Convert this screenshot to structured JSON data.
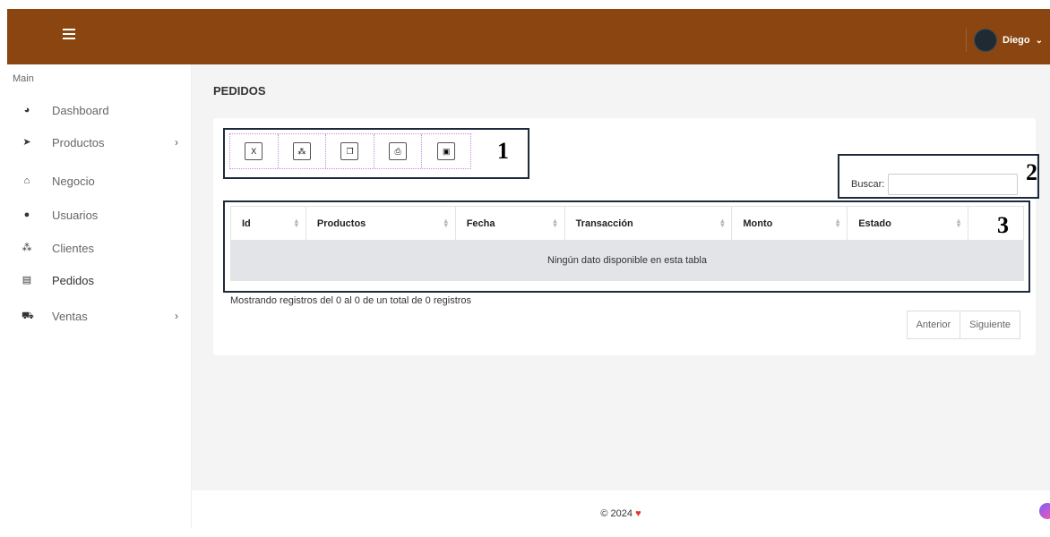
{
  "header": {
    "user_name": "Diego",
    "user_chevron": "⌄",
    "colors": {
      "bar": "#8b4511"
    }
  },
  "sidebar": {
    "section_label": "Main",
    "items": [
      {
        "label": "Dashboard",
        "icon": "pie-chart-icon",
        "glyph": "◕",
        "has_chevron": false
      },
      {
        "label": "Productos",
        "icon": "tags-icon",
        "glyph": "➤",
        "has_chevron": true
      },
      {
        "label": "Negocio",
        "icon": "home-icon",
        "glyph": "⌂",
        "has_chevron": false
      },
      {
        "label": "Usuarios",
        "icon": "user-icon",
        "glyph": "●",
        "has_chevron": false
      },
      {
        "label": "Clientes",
        "icon": "users-icon",
        "glyph": "⁂",
        "has_chevron": false
      },
      {
        "label": "Pedidos",
        "icon": "list-icon",
        "glyph": "▤",
        "has_chevron": false
      },
      {
        "label": "Ventas",
        "icon": "cart-icon",
        "glyph": "⛟",
        "has_chevron": true
      }
    ],
    "chevron": "›"
  },
  "page": {
    "title": "PEDIDOS"
  },
  "export_buttons": [
    {
      "name": "excel-export",
      "icon": "file-excel-icon",
      "glyph": "X"
    },
    {
      "name": "pdf-export",
      "icon": "file-pdf-icon",
      "glyph": "⁂"
    },
    {
      "name": "copy-export",
      "icon": "copy-icon",
      "glyph": "❐"
    },
    {
      "name": "print-export",
      "icon": "print-icon",
      "glyph": "⎙"
    },
    {
      "name": "csv-export",
      "icon": "file-csv-icon",
      "glyph": "▣"
    }
  ],
  "annotations": {
    "one": "1",
    "two": "2",
    "three": "3"
  },
  "search": {
    "label": "Buscar:",
    "value": "",
    "placeholder": ""
  },
  "table": {
    "columns": [
      "Id",
      "Productos",
      "Fecha",
      "Transacción",
      "Monto",
      "Estado"
    ],
    "empty_message": "Ningún dato disponible en esta tabla"
  },
  "info_text": "Mostrando registros del 0 al 0 de un total de 0 registros",
  "pagination": {
    "previous": "Anterior",
    "next": "Siguiente"
  },
  "footer": {
    "text": "© 2024",
    "heart": "♥"
  }
}
